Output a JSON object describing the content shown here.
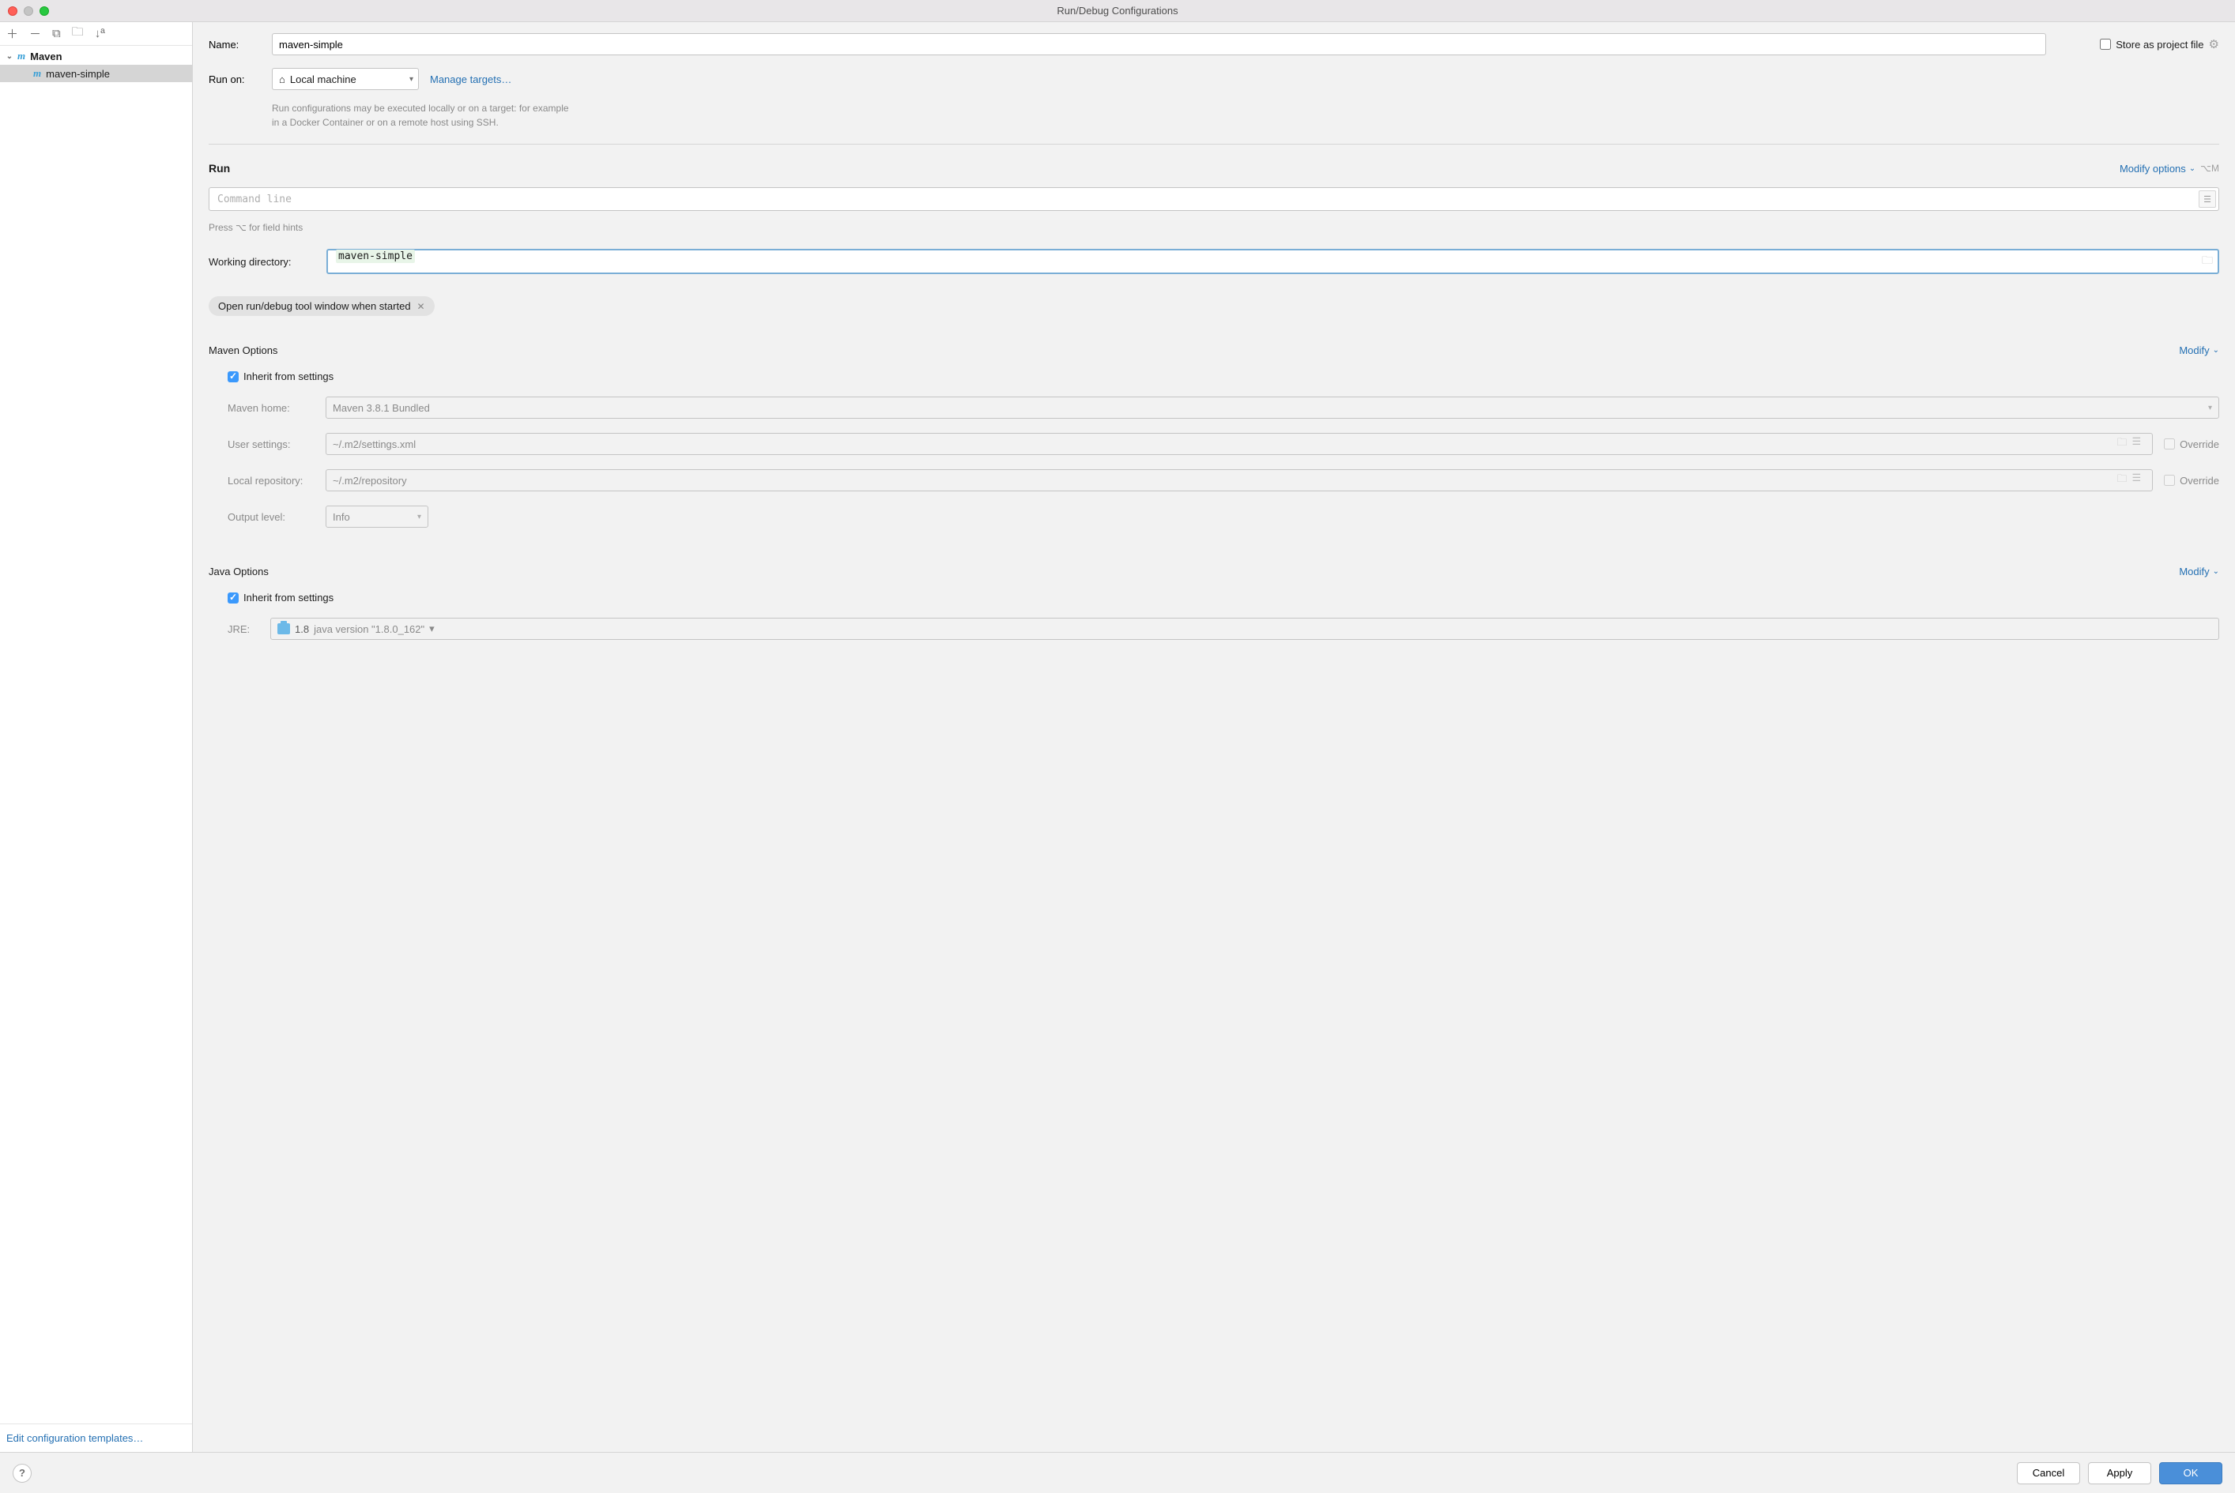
{
  "window": {
    "title": "Run/Debug Configurations"
  },
  "sidebar": {
    "root": {
      "label": "Maven"
    },
    "item": {
      "label": "maven-simple"
    },
    "edit_templates": "Edit configuration templates…"
  },
  "form": {
    "name_label": "Name:",
    "name_value": "maven-simple",
    "store_label": "Store as project file",
    "run_on_label": "Run on:",
    "run_on_value": "Local machine",
    "manage_targets": "Manage targets…",
    "targets_hint1": "Run configurations may be executed locally or on a target: for example",
    "targets_hint2": "in a Docker Container or on a remote host using SSH."
  },
  "run": {
    "title": "Run",
    "modify": "Modify options",
    "shortcut": "⌥M",
    "cmd_placeholder": "Command line",
    "hints": "Press ⌥ for field hints",
    "wd_label": "Working directory:",
    "wd_value": "maven-simple",
    "chip": "Open run/debug tool window when started"
  },
  "maven": {
    "title": "Maven Options",
    "modify": "Modify",
    "inherit": "Inherit from settings",
    "home_label": "Maven home:",
    "home_value": "Maven 3.8.1 Bundled",
    "user_label": "User settings:",
    "user_value": "~/.m2/settings.xml",
    "repo_label": "Local repository:",
    "repo_value": "~/.m2/repository",
    "output_label": "Output level:",
    "output_value": "Info",
    "override": "Override"
  },
  "java": {
    "title": "Java Options",
    "modify": "Modify",
    "inherit": "Inherit from settings",
    "jre_label": "JRE:",
    "jre_strong": "1.8",
    "jre_rest": "java version \"1.8.0_162\""
  },
  "footer": {
    "cancel": "Cancel",
    "apply": "Apply",
    "ok": "OK"
  }
}
